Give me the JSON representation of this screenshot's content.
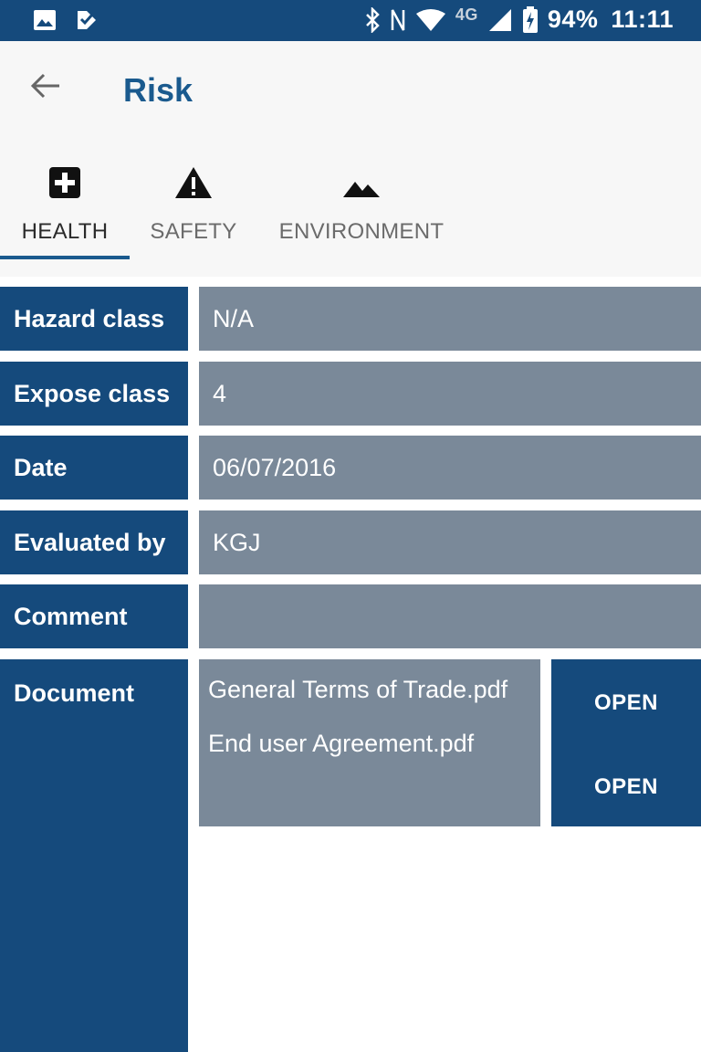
{
  "status_bar": {
    "battery": "94%",
    "time": "11:11",
    "network": "4G",
    "icons": [
      "image-icon",
      "check-badge-icon",
      "bluetooth-icon",
      "nfc-icon",
      "wifi-icon",
      "signal-icon",
      "battery-charging-icon"
    ]
  },
  "header": {
    "title": "Risk",
    "back_icon": "arrow-left-icon"
  },
  "tabs": [
    {
      "label": "HEALTH",
      "icon": "medical-plus-icon",
      "active": true
    },
    {
      "label": "SAFETY",
      "icon": "warning-triangle-icon",
      "active": false
    },
    {
      "label": "ENVIRONMENT",
      "icon": "mountains-icon",
      "active": false
    }
  ],
  "fields": [
    {
      "label": "Hazard class",
      "value": "N/A"
    },
    {
      "label": "Expose class",
      "value": "4"
    },
    {
      "label": "Date",
      "value": "06/07/2016"
    },
    {
      "label": "Evaluated by",
      "value": "KGJ"
    },
    {
      "label": "Comment",
      "value": ""
    }
  ],
  "documents": {
    "label": "Document",
    "items": [
      {
        "name": "General Terms of Trade.pdf",
        "action": "OPEN"
      },
      {
        "name": "End user Agreement.pdf",
        "action": "OPEN"
      }
    ]
  },
  "colors": {
    "primary": "#154a7c",
    "value_bg": "#7a8999",
    "title": "#1a5a8e",
    "appbar_bg": "#f7f7f7"
  }
}
